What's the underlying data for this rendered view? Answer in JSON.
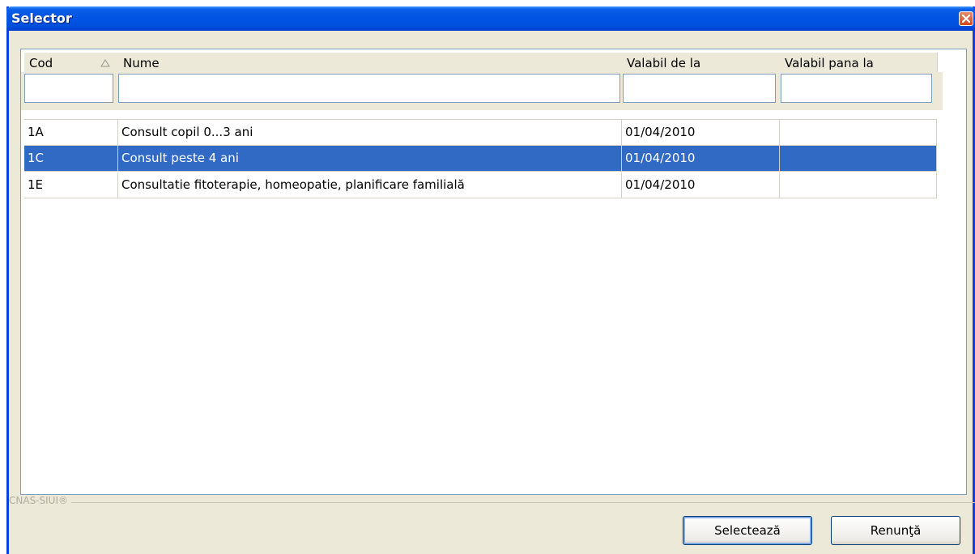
{
  "window": {
    "title": "Selector"
  },
  "grid": {
    "columns": [
      "Cod",
      "Nume",
      "Valabil de la",
      "Valabil pana la"
    ],
    "sort_column": "Cod",
    "sort_direction": "ascending",
    "filters": [
      "",
      "",
      "",
      ""
    ],
    "rows": [
      {
        "cod": "1A",
        "nume": "Consult copil 0...3 ani",
        "valabil_de_la": "01/04/2010",
        "valabil_pana_la": ""
      },
      {
        "cod": "1C",
        "nume": "Consult peste 4 ani",
        "valabil_de_la": "01/04/2010",
        "valabil_pana_la": ""
      },
      {
        "cod": "1E",
        "nume": "Consultatie fitoterapie, homeopatie, planificare familială",
        "valabil_de_la": "01/04/2010",
        "valabil_pana_la": ""
      }
    ],
    "selected_row": 1
  },
  "footer": {
    "group_label": "CNAS-SIUI®"
  },
  "buttons": {
    "select_label": "Selectează",
    "cancel_label": "Renunţă"
  },
  "colors": {
    "titlebar": "#0054e3",
    "selection": "#316ac5",
    "window_bg": "#ece9d8"
  }
}
